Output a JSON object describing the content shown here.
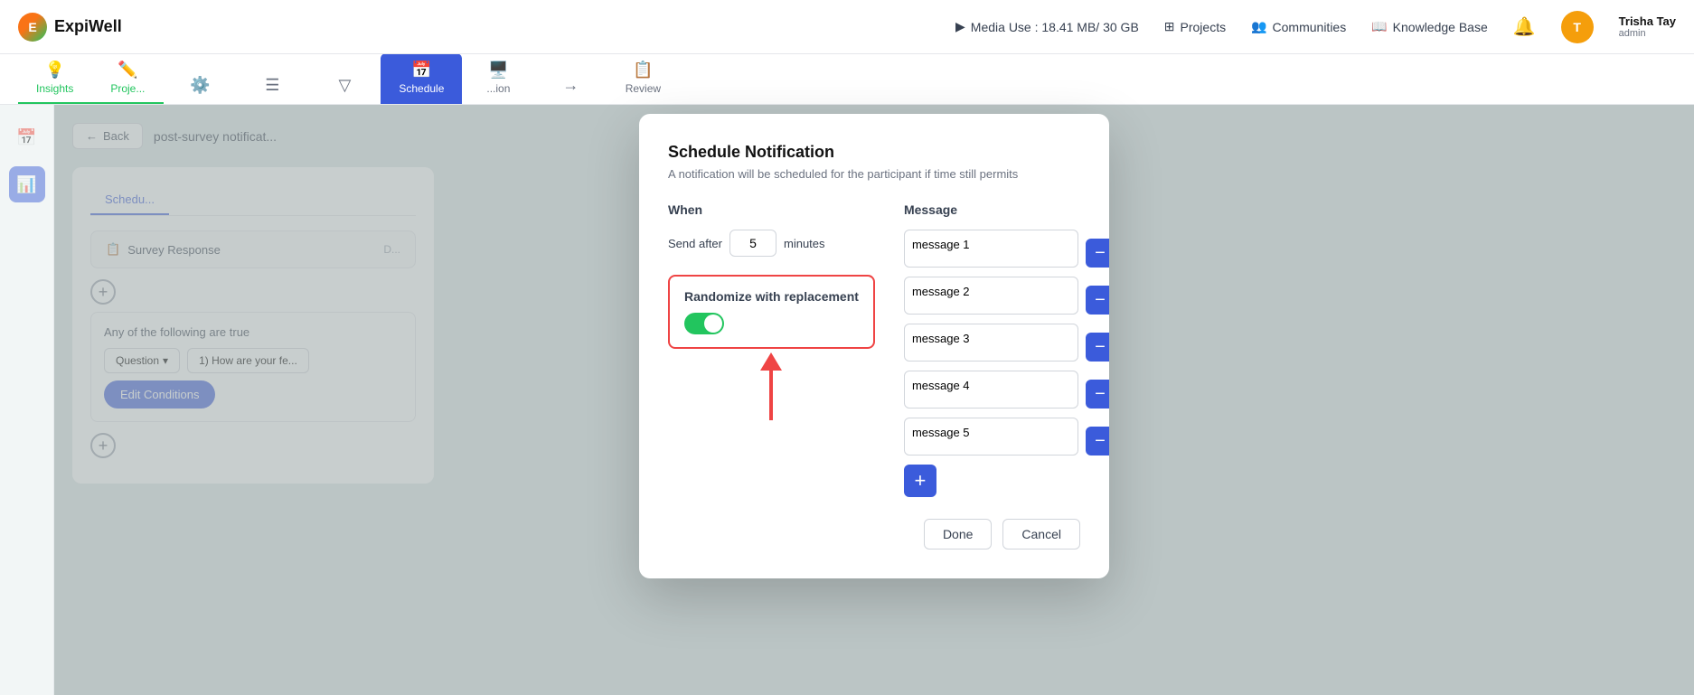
{
  "app": {
    "name": "ExpiWell"
  },
  "topNav": {
    "media_label": "Media Use : 18.41 MB/ 30 GB",
    "projects_label": "Projects",
    "communities_label": "Communities",
    "knowledge_base_label": "Knowledge Base",
    "user_name": "Trisha Tay",
    "user_role": "admin",
    "user_initials": "T"
  },
  "tabs": [
    {
      "id": "insights",
      "label": "Insights",
      "icon": "💡",
      "active_green": true
    },
    {
      "id": "projects",
      "label": "Proje...",
      "icon": "✏️",
      "active_green": true
    },
    {
      "id": "settings",
      "label": "",
      "icon": "⚙️"
    },
    {
      "id": "list",
      "label": "",
      "icon": "☰"
    },
    {
      "id": "filter",
      "label": "",
      "icon": "▽"
    },
    {
      "id": "schedule",
      "label": "Schedule",
      "icon": "📅",
      "active_blue": true
    },
    {
      "id": "more1",
      "label": "...ion",
      "icon": "🖥️"
    },
    {
      "id": "arrow",
      "label": "",
      "icon": "→"
    },
    {
      "id": "review",
      "label": "Review",
      "icon": "📋"
    }
  ],
  "sidebar": {
    "items": [
      {
        "id": "calendar",
        "icon": "📅",
        "active": false
      },
      {
        "id": "chart",
        "icon": "📊",
        "active": true
      }
    ]
  },
  "page": {
    "back_label": "Back",
    "title": "post-survey notificat...",
    "schedule_tab": "Schedu...",
    "card1_label": "Survey Response",
    "condition_text": "Any of the following are true",
    "question_label": "Question",
    "question_value": "1) How are your fe...",
    "edit_conditions_label": "Edit Conditions"
  },
  "modal": {
    "title": "Schedule Notification",
    "subtitle": "A notification will be scheduled for the participant if time still permits",
    "when_label": "When",
    "send_after_label": "Send after",
    "send_after_value": "5",
    "minutes_label": "minutes",
    "randomize_label": "Randomize with replacement",
    "toggle_on": true,
    "message_label": "Message",
    "messages": [
      {
        "id": 1,
        "value": "message 1"
      },
      {
        "id": 2,
        "value": "message 2"
      },
      {
        "id": 3,
        "value": "message 3"
      },
      {
        "id": 4,
        "value": "message 4"
      },
      {
        "id": 5,
        "value": "message 5"
      }
    ],
    "done_label": "Done",
    "cancel_label": "Cancel",
    "add_message_label": "+"
  },
  "colors": {
    "accent_blue": "#3b5bdb",
    "accent_green": "#22c55e",
    "danger_red": "#ef4444"
  }
}
